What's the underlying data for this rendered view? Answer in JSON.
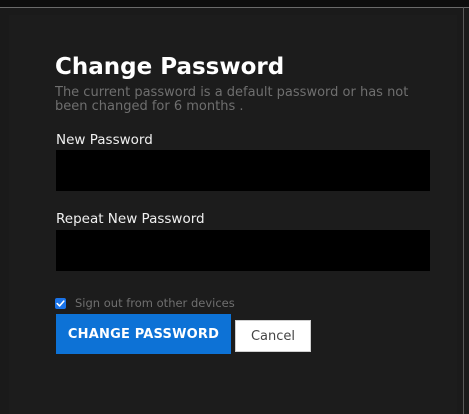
{
  "dialog": {
    "title": "Change Password",
    "subtitle": "The current password is a default password or has not been changed for 6 months ."
  },
  "form": {
    "new_password_label": "New Password",
    "new_password_value": "",
    "repeat_password_label": "Repeat New Password",
    "repeat_password_value": "",
    "signout_label": "Sign out from other devices",
    "signout_checked": true
  },
  "actions": {
    "change_label": "CHANGE PASSWORD",
    "cancel_label": "Cancel"
  },
  "colors": {
    "background": "#1a1a1a",
    "field_background": "#000000",
    "accent": "#0d72d6",
    "muted_text": "#6f6f6f"
  },
  "icons": {
    "checkbox": "checkmark-icon"
  }
}
